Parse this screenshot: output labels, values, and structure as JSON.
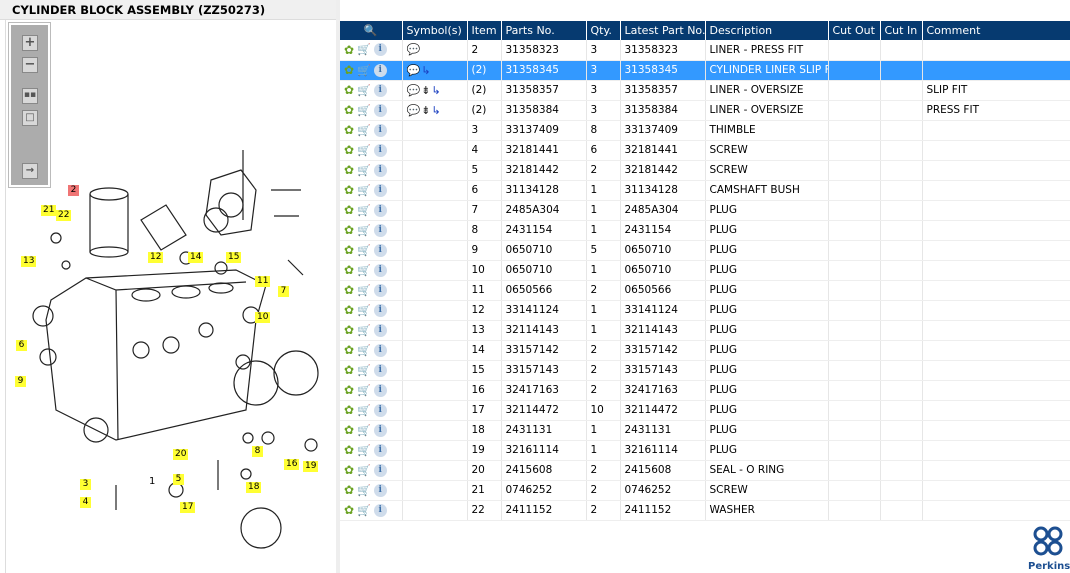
{
  "title": "CYLINDER BLOCK ASSEMBLY (ZZ50273)",
  "toolbar": {
    "zoom_in": "zoom-in-icon",
    "zoom_out": "zoom-out-icon",
    "fit": "fit-all-icon",
    "actual": "actual-size-icon",
    "export": "export-icon"
  },
  "callouts": [
    {
      "label": "2",
      "highlight": true
    },
    {
      "label": "21"
    },
    {
      "label": "22"
    },
    {
      "label": "13"
    },
    {
      "label": "12"
    },
    {
      "label": "14"
    },
    {
      "label": "15"
    },
    {
      "label": "11"
    },
    {
      "label": "7"
    },
    {
      "label": "10"
    },
    {
      "label": "6"
    },
    {
      "label": "9"
    },
    {
      "label": "20"
    },
    {
      "label": "8"
    },
    {
      "label": "16"
    },
    {
      "label": "19"
    },
    {
      "label": "3"
    },
    {
      "label": "5"
    },
    {
      "label": "4"
    },
    {
      "label": "17"
    },
    {
      "label": "18"
    }
  ],
  "diagram_label_1": "1",
  "columns": [
    "",
    "Symbol(s)",
    "Item",
    "Parts No.",
    "Qty.",
    "Latest Part No.",
    "Description",
    "Cut Out",
    "Cut In",
    "Comment"
  ],
  "rows": [
    {
      "symbols": [
        "note"
      ],
      "item": "2",
      "part": "31358323",
      "qty": "3",
      "latest": "31358323",
      "desc": "LINER - PRESS FIT",
      "cut_out": "",
      "cut_in": "",
      "comment": ""
    },
    {
      "symbols": [
        "note",
        "interchange"
      ],
      "item": "(2)",
      "part": "31358345",
      "qty": "3",
      "latest": "31358345",
      "desc": "CYLINDER LINER SLIP FIT",
      "cut_out": "",
      "cut_in": "",
      "comment": "",
      "selected": true
    },
    {
      "symbols": [
        "note",
        "cut",
        "interchange"
      ],
      "item": "(2)",
      "part": "31358357",
      "qty": "3",
      "latest": "31358357",
      "desc": "LINER - OVERSIZE",
      "cut_out": "",
      "cut_in": "",
      "comment": "SLIP FIT"
    },
    {
      "symbols": [
        "note",
        "cut",
        "interchange"
      ],
      "item": "(2)",
      "part": "31358384",
      "qty": "3",
      "latest": "31358384",
      "desc": "LINER - OVERSIZE",
      "cut_out": "",
      "cut_in": "",
      "comment": "PRESS FIT"
    },
    {
      "symbols": [],
      "item": "3",
      "part": "33137409",
      "qty": "8",
      "latest": "33137409",
      "desc": "THIMBLE",
      "comment": ""
    },
    {
      "symbols": [],
      "item": "4",
      "part": "32181441",
      "qty": "6",
      "latest": "32181441",
      "desc": "SCREW",
      "comment": ""
    },
    {
      "symbols": [],
      "item": "5",
      "part": "32181442",
      "qty": "2",
      "latest": "32181442",
      "desc": "SCREW",
      "comment": ""
    },
    {
      "symbols": [],
      "item": "6",
      "part": "31134128",
      "qty": "1",
      "latest": "31134128",
      "desc": "CAMSHAFT BUSH",
      "comment": ""
    },
    {
      "symbols": [],
      "item": "7",
      "part": "2485A304",
      "qty": "1",
      "latest": "2485A304",
      "desc": "PLUG",
      "comment": ""
    },
    {
      "symbols": [],
      "item": "8",
      "part": "2431154",
      "qty": "1",
      "latest": "2431154",
      "desc": "PLUG",
      "comment": ""
    },
    {
      "symbols": [],
      "item": "9",
      "part": "0650710",
      "qty": "5",
      "latest": "0650710",
      "desc": "PLUG",
      "comment": ""
    },
    {
      "symbols": [],
      "item": "10",
      "part": "0650710",
      "qty": "1",
      "latest": "0650710",
      "desc": "PLUG",
      "comment": ""
    },
    {
      "symbols": [],
      "item": "11",
      "part": "0650566",
      "qty": "2",
      "latest": "0650566",
      "desc": "PLUG",
      "comment": ""
    },
    {
      "symbols": [],
      "item": "12",
      "part": "33141124",
      "qty": "1",
      "latest": "33141124",
      "desc": "PLUG",
      "comment": ""
    },
    {
      "symbols": [],
      "item": "13",
      "part": "32114143",
      "qty": "1",
      "latest": "32114143",
      "desc": "PLUG",
      "comment": ""
    },
    {
      "symbols": [],
      "item": "14",
      "part": "33157142",
      "qty": "2",
      "latest": "33157142",
      "desc": "PLUG",
      "comment": ""
    },
    {
      "symbols": [],
      "item": "15",
      "part": "33157143",
      "qty": "2",
      "latest": "33157143",
      "desc": "PLUG",
      "comment": ""
    },
    {
      "symbols": [],
      "item": "16",
      "part": "32417163",
      "qty": "2",
      "latest": "32417163",
      "desc": "PLUG",
      "comment": ""
    },
    {
      "symbols": [],
      "item": "17",
      "part": "32114472",
      "qty": "10",
      "latest": "32114472",
      "desc": "PLUG",
      "comment": ""
    },
    {
      "symbols": [],
      "item": "18",
      "part": "2431131",
      "qty": "1",
      "latest": "2431131",
      "desc": "PLUG",
      "comment": ""
    },
    {
      "symbols": [],
      "item": "19",
      "part": "32161114",
      "qty": "1",
      "latest": "32161114",
      "desc": "PLUG",
      "comment": ""
    },
    {
      "symbols": [],
      "item": "20",
      "part": "2415608",
      "qty": "2",
      "latest": "2415608",
      "desc": "SEAL - O RING",
      "comment": ""
    },
    {
      "symbols": [],
      "item": "21",
      "part": "0746252",
      "qty": "2",
      "latest": "0746252",
      "desc": "SCREW",
      "comment": ""
    },
    {
      "symbols": [],
      "item": "22",
      "part": "2411152",
      "qty": "2",
      "latest": "2411152",
      "desc": "WASHER",
      "comment": ""
    }
  ],
  "logo": {
    "text": "Perkins",
    "color": "#1d4f91"
  },
  "colors": {
    "header": "#063a70",
    "selected": "#3399ff",
    "callout": "#ffff33",
    "callout_highlight": "#f07575"
  }
}
